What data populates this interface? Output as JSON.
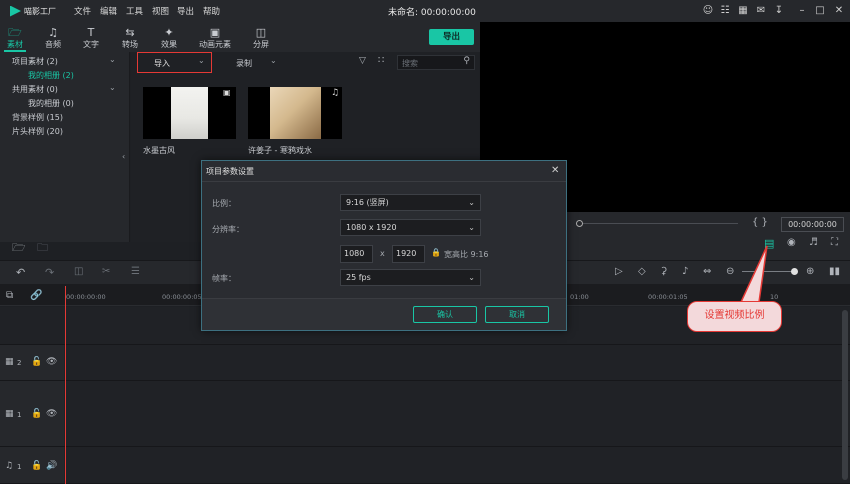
{
  "app": {
    "name": "喵影工厂",
    "window_title": "未命名: 00:00:00:00"
  },
  "menu": [
    "文件",
    "编辑",
    "工具",
    "视图",
    "导出",
    "帮助"
  ],
  "toolbar": {
    "tabs": [
      {
        "label": "素材",
        "icon": "folder-icon"
      },
      {
        "label": "音频",
        "icon": "music-note-icon"
      },
      {
        "label": "文字",
        "icon": "text-icon"
      },
      {
        "label": "转场",
        "icon": "transition-icon"
      },
      {
        "label": "效果",
        "icon": "effects-icon"
      },
      {
        "label": "动画元素",
        "icon": "image-icon"
      },
      {
        "label": "分屏",
        "icon": "split-screen-icon"
      }
    ],
    "export_label": "导出"
  },
  "sidebar": {
    "items": [
      {
        "label": "项目素材 (2)"
      },
      {
        "label": "我的相册 (2)"
      },
      {
        "label": "共用素材 (0)"
      },
      {
        "label": "我的相册 (0)"
      },
      {
        "label": "背景样例 (15)"
      },
      {
        "label": "片头样例 (20)"
      }
    ]
  },
  "media": {
    "import_label": "导入",
    "record_label": "录制",
    "search_placeholder": "搜索",
    "items": [
      {
        "label": "水墨古风",
        "type_icon": "image-icon"
      },
      {
        "label": "许姜子 - 寒鸦戏水",
        "type_icon": "music-note-icon"
      }
    ]
  },
  "preview": {
    "timecode": "00:00:00:00"
  },
  "timeline": {
    "ruler_ticks": [
      "00:00:00:00",
      "00:00:00:05",
      "00:00:00:10",
      "00:00:01:00",
      "00:00:01:05",
      "00:00:01:10"
    ],
    "ruler_ticks_visible": [
      "00:00:00:00",
      "00:00:00:05",
      "01:00",
      "00:00:01:05",
      "10"
    ],
    "tracks": [
      {
        "label": "2",
        "icon": "video-track-icon"
      },
      {
        "label": "1",
        "icon": "video-track-icon"
      },
      {
        "label": "1",
        "icon": "audio-track-icon"
      }
    ]
  },
  "dialog": {
    "title": "项目参数设置",
    "ratio_label": "比例：",
    "ratio_value": "9:16 (竖屏)",
    "resolution_label": "分辨率：",
    "resolution_value": "1080 x 1920",
    "width_value": "1080",
    "x_sep": "x",
    "height_value": "1920",
    "aspect_text": "宽高比 9:16",
    "framerate_label": "帧率：",
    "framerate_value": "25 fps",
    "confirm_label": "确认",
    "cancel_label": "取消"
  },
  "callout": {
    "text": "设置视频比例"
  },
  "colors": {
    "accent": "#19c6a5",
    "highlight_red": "#e53935",
    "background": "#1e2024"
  }
}
